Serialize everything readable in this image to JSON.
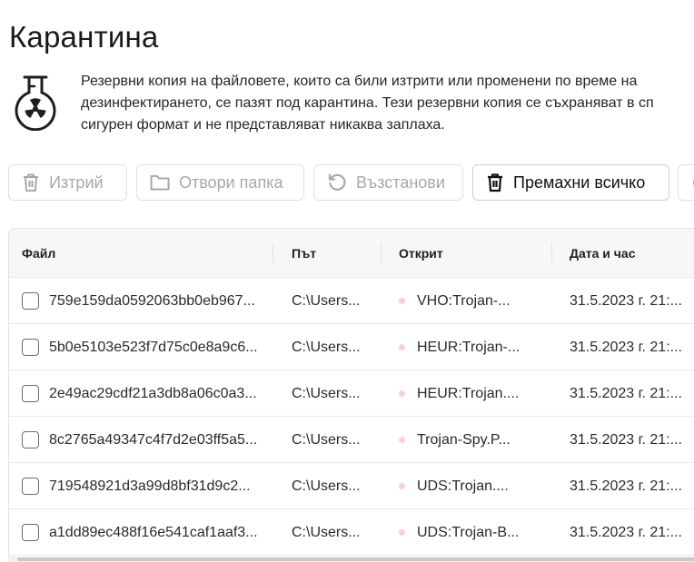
{
  "title": "Карантина",
  "intro": {
    "lines": [
      "Резервни копия на файловете, които са били изтрити или променени по време на",
      "дезинфектирането, се пазят под карантина. Тези резервни копия се съхраняват в сп",
      "сигурен формат и не представляват никаква заплаха."
    ]
  },
  "toolbar": {
    "delete_label": "Изтрий",
    "open_folder_label": "Отвори папка",
    "restore_label": "Възстанови",
    "remove_all_label": "Премахни всичко"
  },
  "table": {
    "headers": {
      "file": "Файл",
      "path": "Път",
      "detected": "Открит",
      "datetime": "Дата и час"
    },
    "rows": [
      {
        "file": "759e159da0592063bb0eb967...",
        "path": "C:\\Users...",
        "detected": "VHO:Trojan-...",
        "datetime": "31.5.2023 г. 21:..."
      },
      {
        "file": "5b0e5103e523f7d75c0e8a9c6...",
        "path": "C:\\Users...",
        "detected": "HEUR:Trojan-...",
        "datetime": "31.5.2023 г. 21:..."
      },
      {
        "file": "2e49ac29cdf21a3db8a06c0a3...",
        "path": "C:\\Users...",
        "detected": "HEUR:Trojan....",
        "datetime": "31.5.2023 г. 21:..."
      },
      {
        "file": "8c2765a49347c4f7d2e03ff5a5...",
        "path": "C:\\Users...",
        "detected": "Trojan-Spy.P...",
        "datetime": "31.5.2023 г. 21:..."
      },
      {
        "file": "719548921d3a99d8bf31d9c2...",
        "path": "C:\\Users...",
        "detected": "UDS:Trojan....",
        "datetime": "31.5.2023 г. 21:..."
      },
      {
        "file": "a1dd89ec488f16e541caf1aaf3...",
        "path": "C:\\Users...",
        "detected": "UDS:Trojan-B...",
        "datetime": "31.5.2023 г. 21:..."
      }
    ]
  },
  "colors": {
    "threat_dot": "#f6d3d3",
    "disabled_text": "#a8a8a8",
    "header_bg": "#f7f7f7"
  }
}
